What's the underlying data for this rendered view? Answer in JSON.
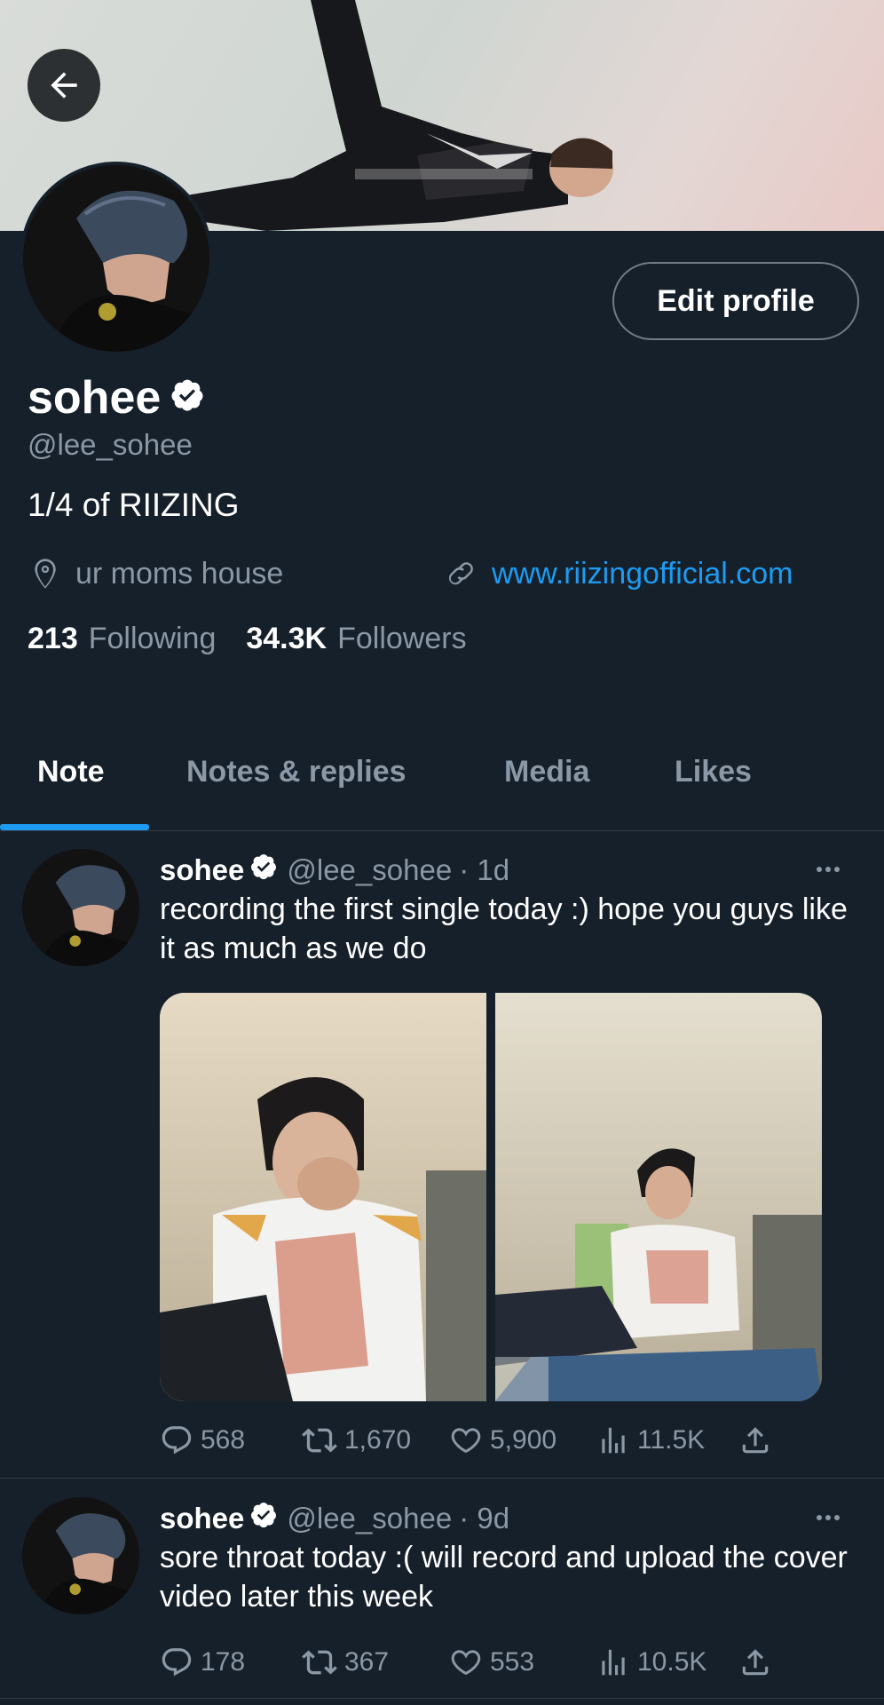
{
  "profile": {
    "name": "sohee",
    "handle": "@lee_sohee",
    "bio": "1/4 of RIIZING",
    "location": "ur moms house",
    "website": "www.riizingofficial.com",
    "following_count": "213",
    "following_label": "Following",
    "followers_count": "34.3K",
    "followers_label": "Followers",
    "edit_label": "Edit profile"
  },
  "tabs": [
    {
      "label": "Note",
      "active": true
    },
    {
      "label": "Notes & replies",
      "active": false
    },
    {
      "label": "Media",
      "active": false
    },
    {
      "label": "Likes",
      "active": false
    }
  ],
  "posts": [
    {
      "name": "sohee",
      "handle": "@lee_sohee",
      "time": "· 1d",
      "text": "recording the first single today :) hope you guys like it as much as we do",
      "replies": "568",
      "reposts": "1,670",
      "likes": "5,900",
      "views": "11.5K"
    },
    {
      "name": "sohee",
      "handle": "@lee_sohee",
      "time": "· 9d",
      "text": "sore throat today :( will record and upload the cover video later this week",
      "replies": "178",
      "reposts": "367",
      "likes": "553",
      "views": "10.5K"
    }
  ],
  "colors": {
    "background": "#15202b",
    "accent": "#1d9bf0",
    "muted": "#8b98a5"
  }
}
